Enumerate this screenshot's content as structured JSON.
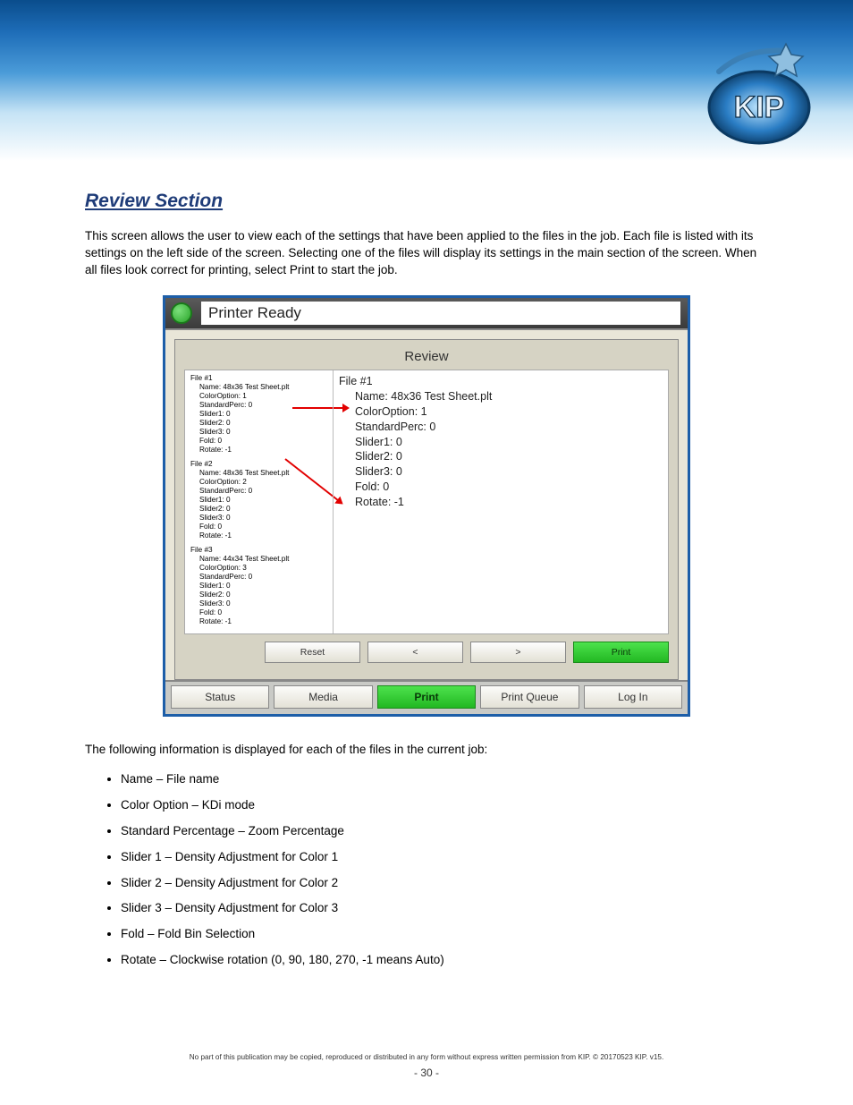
{
  "header": {
    "logo_alt": "KIP"
  },
  "section": {
    "title": "Review Section",
    "intro": "This screen allows the user to view each of the settings that have been applied to the files in the job. Each file is listed with its settings on the left side of the screen. Selecting one of the files will display its settings in the main section of the screen. When all files look correct for printing, select Print to start the job."
  },
  "app": {
    "title": "Printer Ready",
    "panel_title": "Review",
    "files": [
      {
        "header": "File #1",
        "rows": [
          "Name: 48x36 Test Sheet.plt",
          "ColorOption: 1",
          "StandardPerc: 0",
          "Slider1: 0",
          "Slider2: 0",
          "Slider3: 0",
          "Fold: 0",
          "Rotate: -1"
        ]
      },
      {
        "header": "File #2",
        "rows": [
          "Name: 48x36 Test Sheet.plt",
          "ColorOption: 2",
          "StandardPerc: 0",
          "Slider1: 0",
          "Slider2: 0",
          "Slider3: 0",
          "Fold: 0",
          "Rotate: -1"
        ]
      },
      {
        "header": "File #3",
        "rows": [
          "Name: 44x34 Test Sheet.plt",
          "ColorOption: 3",
          "StandardPerc: 0",
          "Slider1: 0",
          "Slider2: 0",
          "Slider3: 0",
          "Fold: 0",
          "Rotate: -1"
        ]
      }
    ],
    "detail": {
      "header": "File #1",
      "rows": [
        "Name: 48x36 Test Sheet.plt",
        "ColorOption: 1",
        "StandardPerc: 0",
        "Slider1: 0",
        "Slider2: 0",
        "Slider3: 0",
        "Fold: 0",
        "Rotate: -1"
      ]
    },
    "actions": {
      "reset": "Reset",
      "prev": "<",
      "next": ">",
      "print": "Print"
    },
    "nav": {
      "status": "Status",
      "media": "Media",
      "print": "Print",
      "queue": "Print Queue",
      "login": "Log In"
    }
  },
  "info_line": "The following information is displayed for each of the files in the current job:",
  "attributes": [
    "Name – File name",
    "Color Option – KDi mode",
    "Standard Percentage – Zoom Percentage",
    "Slider 1 – Density Adjustment for Color 1",
    "Slider 2 – Density Adjustment for Color 2",
    "Slider 3 – Density Adjustment for Color 3",
    "Fold – Fold Bin Selection",
    "Rotate – Clockwise rotation (0, 90, 180, 270, -1 means Auto)"
  ],
  "footer": {
    "line1": "No part of this publication may be copied, reproduced or distributed in any form without express written permission from KIP. © 20170523 KIP. v15.",
    "pagenum": "- 30 -"
  }
}
